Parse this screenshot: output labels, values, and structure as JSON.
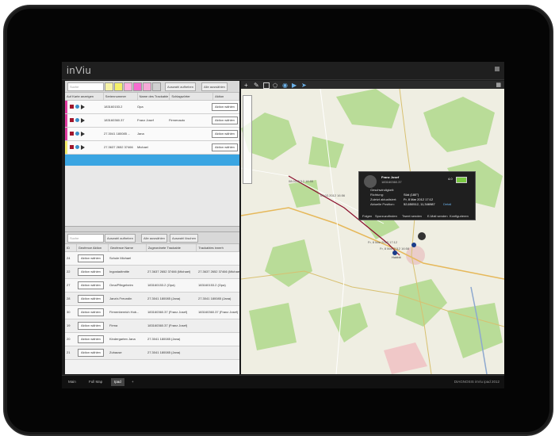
{
  "app": {
    "title": "inViu"
  },
  "top_panel": {
    "search_placeholder": "Suche",
    "swatch_colors": [
      "#f6f3a8",
      "#f4f06a",
      "#ffb0de",
      "#f76bd0",
      "#f5a9d6",
      "#d0d0d0"
    ],
    "btn_show_all": "Auswahl aufheben",
    "btn_all_select": "Alle auswählen",
    "columns": [
      "Auf Karte anzeigen",
      "Seriennummer",
      "Name des Trackable",
      "Schlagwörter",
      "Aktion"
    ],
    "rows": [
      {
        "serial": "183160153.2",
        "name": "Opa",
        "tags": "",
        "action": "Aktion wählen",
        "color": "#e03ca0"
      },
      {
        "serial": "183160360.37",
        "name": "Franz Josef",
        "tags": "Firmenauto",
        "action": "Aktion wählen",
        "color": "#e03ca0"
      },
      {
        "serial": "27.3041 180085 ...",
        "name": "Jana",
        "tags": "",
        "action": "Aktion wählen",
        "color": "#e03ca0"
      },
      {
        "serial": "27.3637 2652 37466",
        "name": "Michael",
        "tags": "",
        "action": "Aktion wählen",
        "color": "#f3ec6a"
      }
    ]
  },
  "bottom_panel": {
    "search_placeholder": "Suche",
    "btn_show_all": "Auswahl aufheben",
    "btn_select_all": "Alle auswählen",
    "btn_delete": "Auswahl löschen",
    "columns": [
      "ID",
      "Geofence Aktion",
      "Geofence Name",
      "Zugeordnete Trackable",
      "Trackables innerh"
    ],
    "rows": [
      {
        "id": "24",
        "action": "Aktion wählen",
        "name": "Schule Michael",
        "assigned": "",
        "inside": ""
      },
      {
        "id": "22",
        "action": "Aktion wählen",
        "name": "Ingostadtmitte",
        "assigned": "27.3637 2652 37466 (Michael)",
        "inside": "27.3637 2652 37466 (Michael)"
      },
      {
        "id": "27",
        "action": "Aktion wählen",
        "name": "Oma/Pflegeheim",
        "assigned": "183160153.2 (Opa)",
        "inside": "183160153.2 (Opa)"
      },
      {
        "id": "28",
        "action": "Aktion wählen",
        "name": "Jana's Freundin",
        "assigned": "27.3041 180085 (Jana)",
        "inside": "27.3041 180085 (Jana)"
      },
      {
        "id": "30",
        "action": "Aktion wählen",
        "name": "Firmenbereich Hob...",
        "assigned": "183160360.37 (Franz Josef)",
        "inside": "183160360.37 (Franz Josef)"
      },
      {
        "id": "19",
        "action": "Aktion wählen",
        "name": "Firma",
        "assigned": "183160360.37 (Franz Josef)",
        "inside": ""
      },
      {
        "id": "20",
        "action": "Aktion wählen",
        "name": "Kindergarten Jana",
        "assigned": "27.3041 180085 (Jana)",
        "inside": ""
      },
      {
        "id": "21",
        "action": "Aktion wählen",
        "name": "Zuhause",
        "assigned": "27.3041 180085 (Jana)",
        "inside": ""
      }
    ]
  },
  "popup": {
    "name": "Franz Josef",
    "id": "183160360.37",
    "battery": "4.0",
    "fields": [
      {
        "k": "Geschwindigkeit:",
        "v": ""
      },
      {
        "k": "Richtung:",
        "v": "Süd (180°)"
      },
      {
        "k": "Zuletzt aktualisiert:",
        "v": "Fr, 8 Mar 2012 17:12"
      },
      {
        "k": "Aktuelle Position:",
        "v": "52,650512, 11,346987"
      }
    ],
    "detail_link": "Detail",
    "actions": [
      "Folgen",
      "Spurzuzufinden",
      "Tweet senden",
      "E-Mail senden",
      "Konfigurieren"
    ]
  },
  "map_labels": [
    "08.03.2012 16:55",
    "09.03.2012 16:56",
    "Fr, 8 Mar 2012 17:12",
    "Fr, 8 Mar 2012 16:58",
    "Hobbit"
  ],
  "bottom_tabs": [
    "Main",
    "Full Map",
    "Ipad",
    "+"
  ],
  "status": "DIAGNOSIS inViu ipad 2012"
}
